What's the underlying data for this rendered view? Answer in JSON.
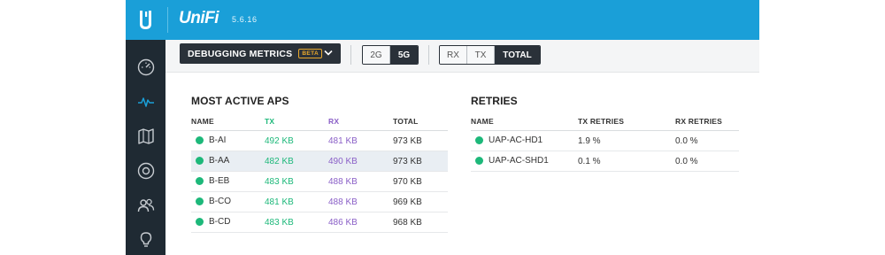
{
  "app": {
    "brand": "UniFi",
    "version": "5.6.16"
  },
  "sidebar": {
    "items": [
      {
        "name": "dashboard",
        "icon": "speedometer-icon"
      },
      {
        "name": "statistics",
        "icon": "pulse-icon"
      },
      {
        "name": "map",
        "icon": "map-icon"
      },
      {
        "name": "devices",
        "icon": "device-icon"
      },
      {
        "name": "clients",
        "icon": "users-icon"
      },
      {
        "name": "insights",
        "icon": "lightbulb-icon"
      }
    ]
  },
  "toolbar": {
    "dropdown_label": "DEBUGGING METRICS",
    "beta_badge": "BETA",
    "band_options": [
      "2G",
      "5G"
    ],
    "band_selected": "5G",
    "traffic_options": [
      "RX",
      "TX",
      "TOTAL"
    ],
    "traffic_selected": "TOTAL"
  },
  "most_active": {
    "title": "MOST ACTIVE APS",
    "columns": [
      "NAME",
      "TX",
      "RX",
      "TOTAL"
    ],
    "rows": [
      {
        "name": "B-AI",
        "tx": "492 KB",
        "rx": "481 KB",
        "total": "973 KB",
        "status": "online"
      },
      {
        "name": "B-AA",
        "tx": "482 KB",
        "rx": "490 KB",
        "total": "973 KB",
        "status": "online"
      },
      {
        "name": "B-EB",
        "tx": "483 KB",
        "rx": "488 KB",
        "total": "970 KB",
        "status": "online"
      },
      {
        "name": "B-CO",
        "tx": "481 KB",
        "rx": "488 KB",
        "total": "969 KB",
        "status": "online"
      },
      {
        "name": "B-CD",
        "tx": "483 KB",
        "rx": "486 KB",
        "total": "968 KB",
        "status": "online"
      }
    ]
  },
  "retries": {
    "title": "RETRIES",
    "columns": [
      "NAME",
      "TX RETRIES",
      "RX RETRIES"
    ],
    "rows": [
      {
        "name": "UAP-AC-HD1",
        "tx": "1.9 %",
        "rx": "0.0 %",
        "status": "online"
      },
      {
        "name": "UAP-AC-SHD1",
        "tx": "0.1 %",
        "rx": "0.0 %",
        "status": "online"
      }
    ]
  },
  "colors": {
    "header_blue": "#1a9fd8",
    "sidebar_dark": "#1f2a33",
    "tx_green": "#1db87a",
    "rx_purple": "#8a5fc7",
    "beta_orange": "#e8a82c"
  }
}
